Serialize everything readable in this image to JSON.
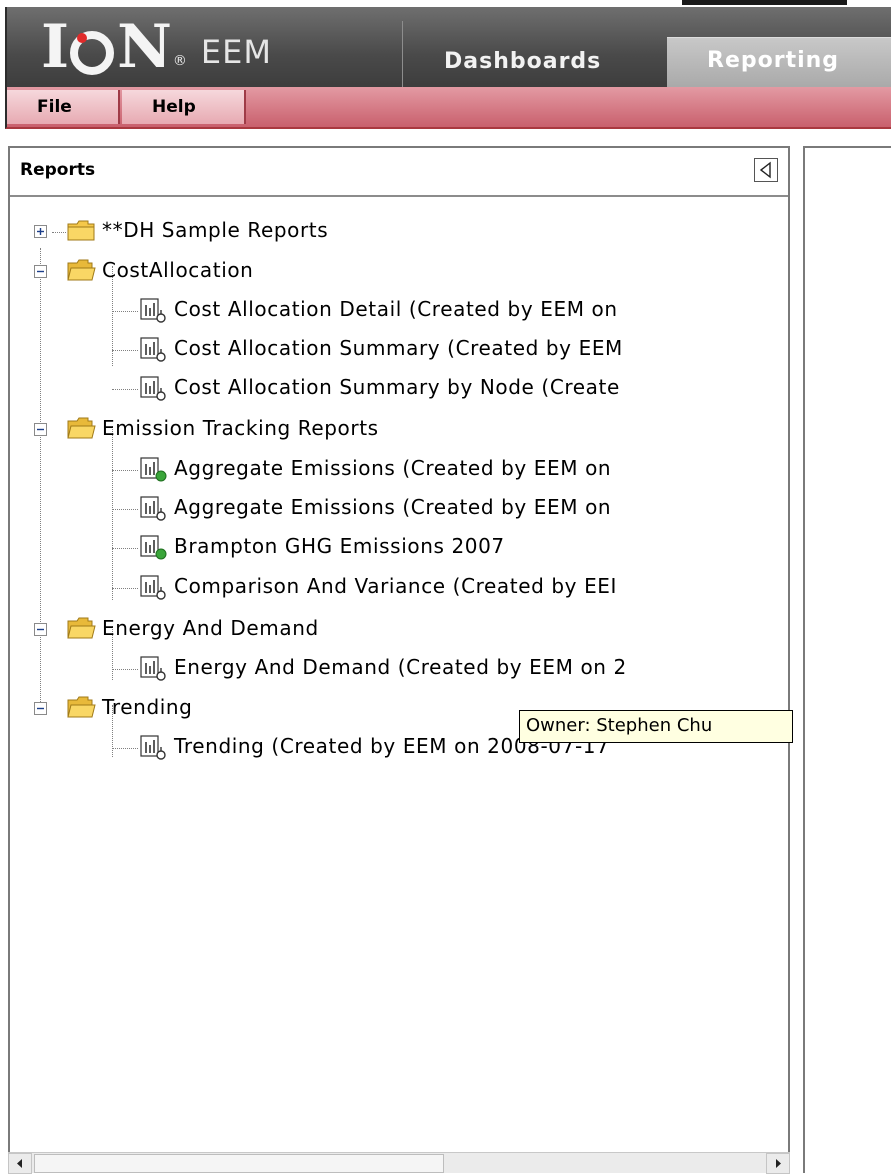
{
  "app": {
    "logo_text_left": "I",
    "logo_text_right": "N",
    "logo_registered": "®",
    "logo_sub": "EEM"
  },
  "tabs": [
    {
      "label": "Dashboards",
      "active": false
    },
    {
      "label": "Reporting",
      "active": true
    }
  ],
  "menu": {
    "file": "File",
    "help": "Help"
  },
  "reports_panel": {
    "title": "Reports",
    "tree": [
      {
        "type": "folder",
        "label": "**DH Sample Reports",
        "expanded": false
      },
      {
        "type": "folder",
        "label": "CostAllocation",
        "expanded": true
      },
      {
        "type": "report",
        "label": "Cost Allocation Detail (Created by EEM on",
        "status": "none"
      },
      {
        "type": "report",
        "label": "Cost Allocation Summary (Created by EEM",
        "status": "none"
      },
      {
        "type": "report",
        "label": "Cost Allocation Summary by Node (Create",
        "status": "none"
      },
      {
        "type": "folder",
        "label": "Emission Tracking Reports",
        "expanded": true
      },
      {
        "type": "report",
        "label": "Aggregate Emissions (Created by EEM on",
        "status": "green"
      },
      {
        "type": "report",
        "label": "Aggregate Emissions (Created by EEM on",
        "status": "none"
      },
      {
        "type": "report",
        "label": "Brampton GHG Emissions 2007",
        "status": "green"
      },
      {
        "type": "report",
        "label": "Comparison And Variance (Created by EEI",
        "status": "none"
      },
      {
        "type": "folder",
        "label": "Energy And Demand",
        "expanded": true
      },
      {
        "type": "report",
        "label": "Energy And Demand (Created by EEM on 2",
        "status": "none"
      },
      {
        "type": "folder",
        "label": "Trending",
        "expanded": true
      },
      {
        "type": "report",
        "label": "Trending (Created by EEM on 2008-07-17",
        "status": "none"
      }
    ]
  },
  "tooltip": {
    "text": "Owner: Stephen Chu"
  },
  "colors": {
    "header_bg": "#4a4a4a",
    "menubar_bg": "#d27a85",
    "tooltip_bg": "#ffffe1",
    "folder": "#f5c84a",
    "status_green": "#3aa53a"
  },
  "icons": {
    "folder": "folder-icon",
    "report": "report-icon",
    "expand": "plus-icon",
    "collapse": "minus-icon",
    "panel_collapse": "triangle-left-icon",
    "scroll_left": "arrow-left-icon",
    "scroll_right": "arrow-right-icon"
  }
}
